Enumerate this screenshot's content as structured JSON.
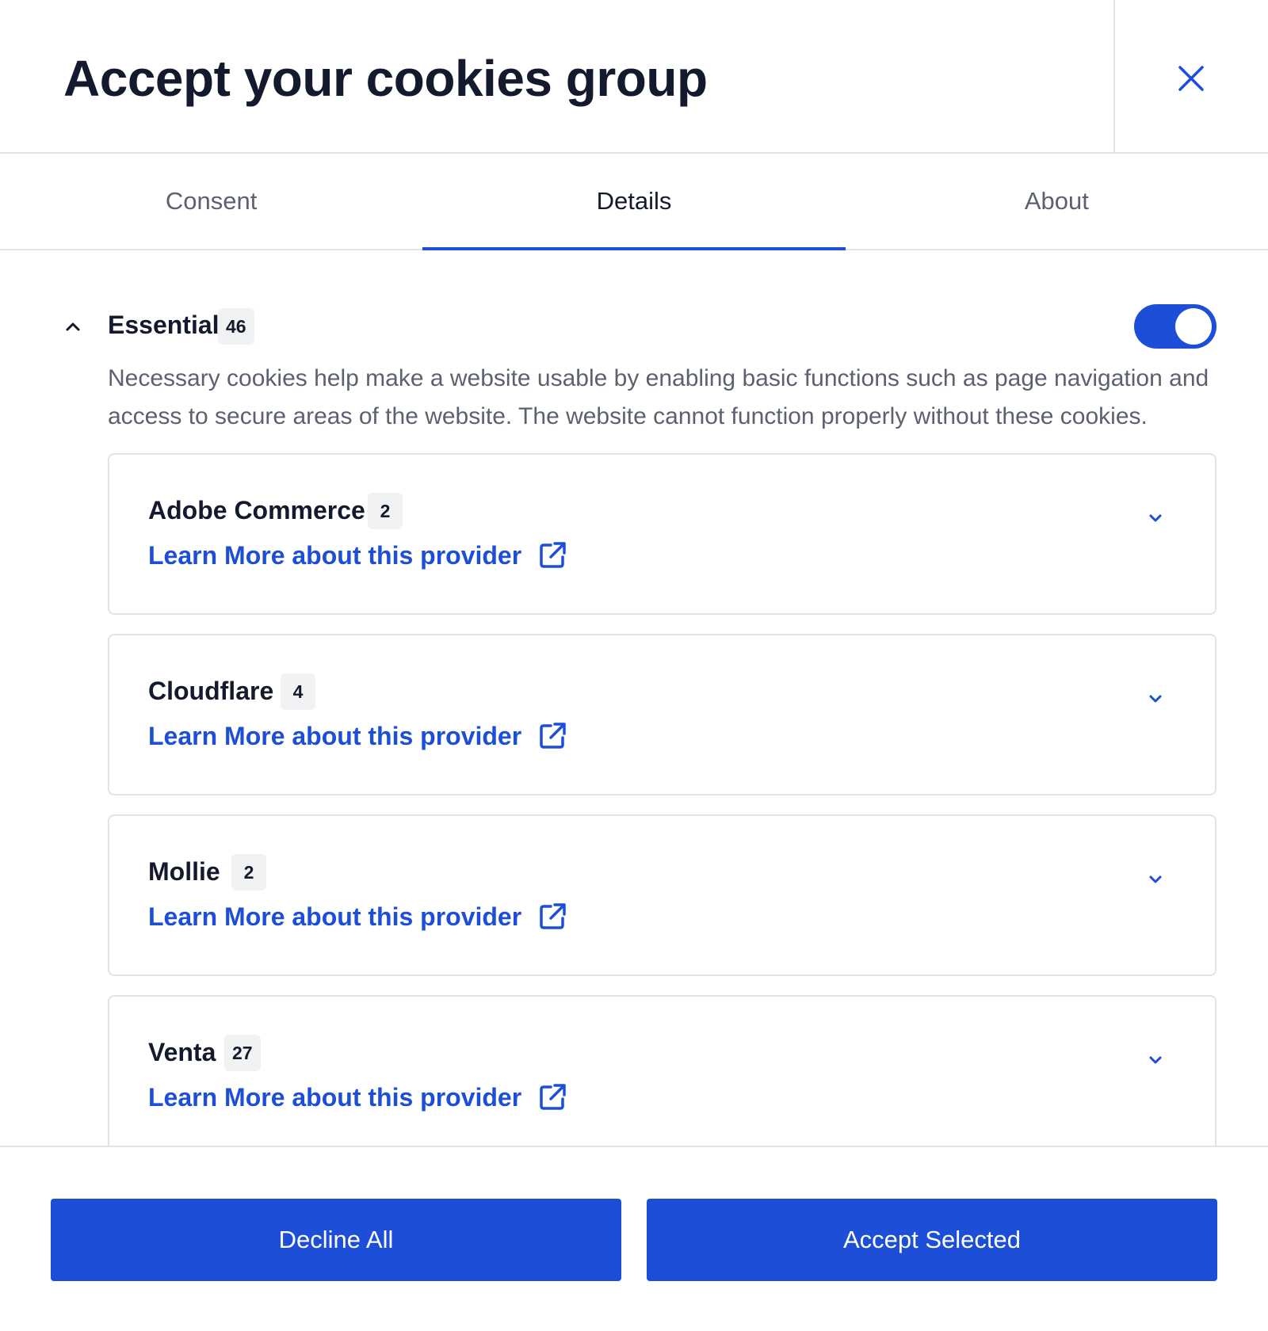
{
  "dialog": {
    "title": "Accept your cookies group",
    "close_icon": "close-icon"
  },
  "tabs": [
    {
      "label": "Consent",
      "active": false
    },
    {
      "label": "Details",
      "active": true
    },
    {
      "label": "About",
      "active": false
    }
  ],
  "group": {
    "title": "Essential",
    "count": "46",
    "expanded": true,
    "enabled": true,
    "description": "Necessary cookies help make a website usable by enabling basic functions such as page navigation and access to secure areas of the website. The website cannot function properly without these cookies."
  },
  "providers": [
    {
      "name": "Adobe Commerce",
      "count": "2",
      "link_label": "Learn More about this provider"
    },
    {
      "name": "Cloudflare",
      "count": "4",
      "link_label": "Learn More about this provider"
    },
    {
      "name": "Mollie",
      "count": "2",
      "link_label": "Learn More about this provider"
    },
    {
      "name": "Venta",
      "count": "27",
      "link_label": "Learn More about this provider"
    }
  ],
  "footer": {
    "decline_label": "Decline All",
    "accept_label": "Accept Selected"
  },
  "colors": {
    "accent": "#1d4ed8",
    "text": "#141a2e",
    "muted": "#5b6170",
    "border": "#e1e3e8",
    "badge_bg": "#f1f2f4"
  }
}
